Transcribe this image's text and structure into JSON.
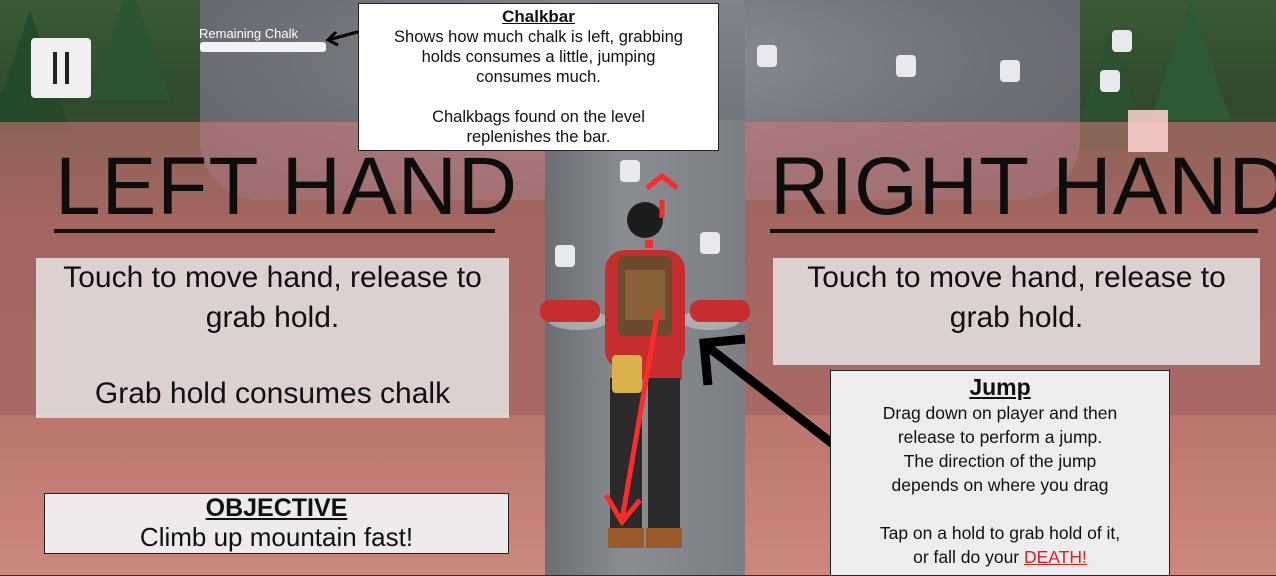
{
  "hud": {
    "pause_icon": "pause-icon",
    "chalk_label": "Remaining Chalk",
    "chalk_level": 1.0
  },
  "chalkbar_help": {
    "title": "Chalkbar",
    "line1": "Shows how much chalk is left, grabbing",
    "line2": "holds consumes a little, jumping",
    "line3": "consumes much.",
    "line4": "Chalkbags found on the level",
    "line5": "replenishes the bar."
  },
  "left_hand": {
    "title": "LEFT HAND",
    "line1": "Touch to move hand, release to",
    "line2": "grab hold.",
    "line3": "Grab hold consumes chalk"
  },
  "right_hand": {
    "title": "RIGHT HAND",
    "line1": "Touch to move hand, release to",
    "line2": "grab hold."
  },
  "objective": {
    "title": "OBJECTIVE",
    "text": "Climb up mountain fast!"
  },
  "jump": {
    "title": "Jump",
    "line1": "Drag down on player and then",
    "line2": "release to perform a jump.",
    "line3": "The direction of the jump",
    "line4": "depends on where you drag",
    "line5": "Tap on a hold to grab hold of it,",
    "line6_prefix": "or fall do your ",
    "line6_death": "DEATH!"
  },
  "colors": {
    "zone_tint": "#d67878",
    "arrow_red": "#ff2a2a",
    "death_red": "#e02020"
  }
}
